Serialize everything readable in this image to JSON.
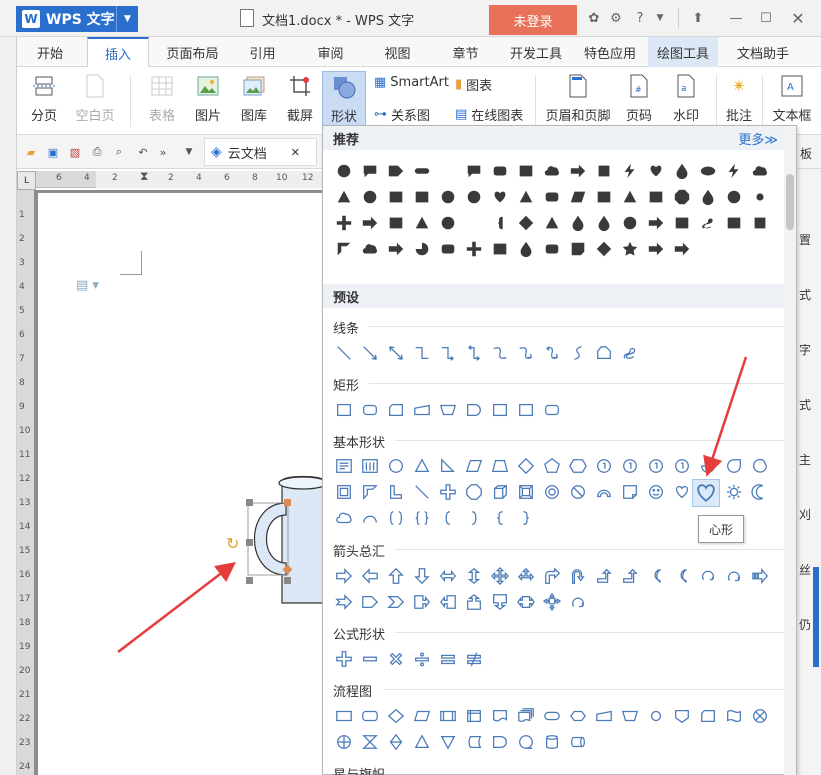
{
  "titlebar": {
    "app_name": "WPS 文字",
    "app_letter": "W",
    "doc_title": "文档1.docx * - WPS 文字",
    "login_label": "未登录"
  },
  "tabs": [
    "开始",
    "插入",
    "页面布局",
    "引用",
    "审阅",
    "视图",
    "章节",
    "开发工具",
    "特色应用",
    "绘图工具",
    "文档助手"
  ],
  "active_tab": "插入",
  "ribbon": {
    "fenye": "分页",
    "kongbaiye": "空白页",
    "biaoge": "表格",
    "tupian": "图片",
    "tuku": "图库",
    "jieping": "截屏",
    "xingzhuang": "形状",
    "smartart": "SmartArt",
    "tubiao": "图表",
    "guanxitu": "关系图",
    "zaixiantubiao": "在线图表",
    "yemeiyejiao": "页眉和页脚",
    "yema": "页码",
    "shuiyin": "水印",
    "pizhu": "批注",
    "wenbenkuang": "文本框"
  },
  "quickbar": {
    "cloud_doc": "云文档",
    "right_char": "板"
  },
  "ruler_numbers": [
    "6",
    "4",
    "2",
    "",
    "2",
    "4",
    "6",
    "8",
    "10",
    "12"
  ],
  "vruler_numbers": [
    "1",
    "2",
    "3",
    "4",
    "5",
    "6",
    "7",
    "8",
    "9",
    "10",
    "11",
    "12",
    "13",
    "14",
    "15",
    "16",
    "17",
    "18",
    "19",
    "20",
    "21",
    "22",
    "23",
    "24"
  ],
  "right_strip_chars": [
    "置",
    "式",
    "字",
    "式",
    "主",
    "刈",
    "丝",
    "仍"
  ],
  "panel": {
    "recommended_title": "推荐",
    "more_label": "更多≫",
    "preset_title": "预设",
    "categories": {
      "lines": "线条",
      "rect": "矩形",
      "basic": "基本形状",
      "arrows": "箭头总汇",
      "formula": "公式形状",
      "flowchart": "流程图",
      "stars": "星与旗帜"
    }
  },
  "tooltip": "心形",
  "colors": {
    "brand_blue": "#2a6fce",
    "login_red": "#e8715a",
    "shape_stroke": "#4a7ab8",
    "annotation_red": "#e63c3c"
  }
}
